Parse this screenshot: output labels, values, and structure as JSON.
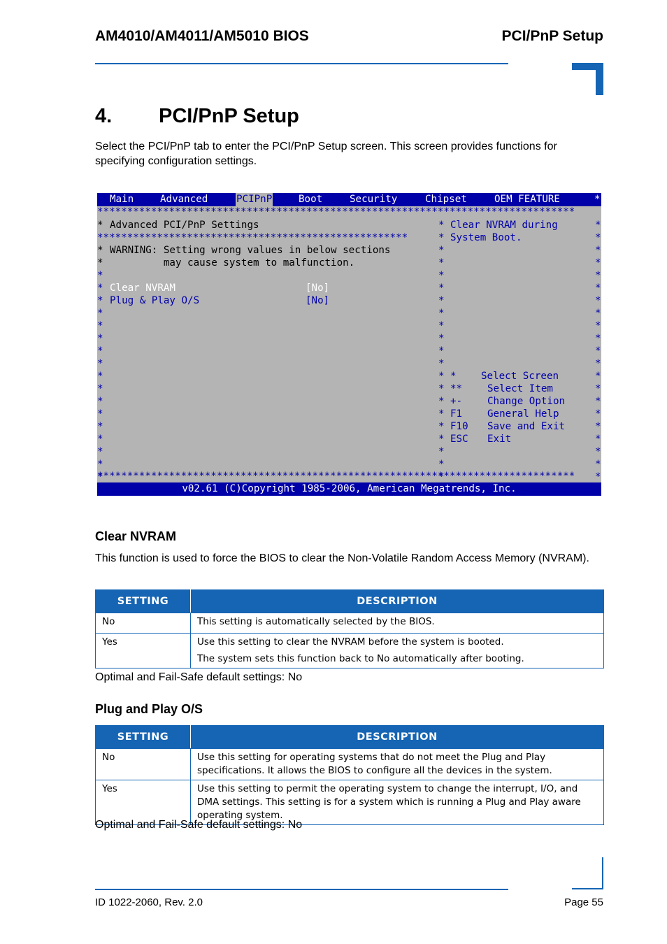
{
  "header": {
    "left_title": "AM4010/AM4011/AM5010 BIOS",
    "right_title": "PCI/PnP Setup"
  },
  "chapter": {
    "number": "4.",
    "title": "PCI/PnP Setup",
    "intro": "Select the PCI/PnP tab to enter the PCI/PnP Setup screen. This screen provides functions for specifying configuration settings."
  },
  "bios_screen": {
    "tabs": [
      "Main",
      "Advanced",
      "PCIPnP",
      "Boot",
      "Security",
      "Chipset",
      "OEM FEATURE"
    ],
    "active_tab": "PCIPnP",
    "tab_overflow": "*",
    "star_rule": "********************************************************************************",
    "section_title": "Advanced PCI/PnP Settings",
    "section_rule": "****************************************************",
    "warning_line1": "WARNING: Setting wrong values in below sections",
    "warning_line2": "         may cause system to malfunction.",
    "items": [
      {
        "label": "Clear NVRAM",
        "value": "[No]",
        "selected": true
      },
      {
        "label": "Plug & Play O/S",
        "value": "[No]",
        "selected": false
      }
    ],
    "help_text": [
      "Clear NVRAM during",
      "System Boot."
    ],
    "key_help": [
      {
        "key": "*",
        "action": "Select Screen"
      },
      {
        "key": "**",
        "action": "Select Item"
      },
      {
        "key": "+-",
        "action": "Change Option"
      },
      {
        "key": "F1",
        "action": "General Help"
      },
      {
        "key": "F10",
        "action": "Save and Exit"
      },
      {
        "key": "ESC",
        "action": "Exit"
      }
    ],
    "footer": "v02.61 (C)Copyright 1985-2006, American Megatrends, Inc."
  },
  "sections": [
    {
      "heading": "Clear NVRAM",
      "description": "This function is used to force the BIOS to clear the Non-Volatile Random Access Memory (NVRAM).",
      "table": {
        "headers": [
          "SETTING",
          "DESCRIPTION"
        ],
        "rows": [
          {
            "setting": "No",
            "description": [
              "This setting is automatically selected by the BIOS."
            ]
          },
          {
            "setting": "Yes",
            "description": [
              "Use this setting to clear the NVRAM before the system is booted.",
              "The system sets this function back to No automatically after booting."
            ]
          }
        ]
      },
      "default_note": "Optimal and Fail-Safe default settings: No"
    },
    {
      "heading": "Plug and Play O/S",
      "table": {
        "headers": [
          "SETTING",
          "DESCRIPTION"
        ],
        "rows": [
          {
            "setting": "No",
            "description": [
              "Use this setting for operating systems that do not meet the Plug and Play specifications. It allows the BIOS to configure all the devices in the system."
            ]
          },
          {
            "setting": "Yes",
            "description": [
              "Use this setting to permit the operating system to change the interrupt, I/O, and DMA settings. This setting is for a system which is running a Plug and Play aware operating system."
            ]
          }
        ]
      },
      "default_note": "Optimal and Fail-Safe default settings: No"
    }
  ],
  "footer": {
    "doc_id": "ID 1022-2060, Rev. 2.0",
    "page": "Page 55"
  },
  "colors": {
    "accent_blue": "#1565b4",
    "bios_blue": "#0000a8",
    "bios_gray": "#b4b4b4"
  }
}
